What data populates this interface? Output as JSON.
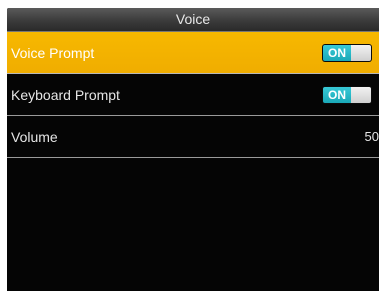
{
  "title": "Voice",
  "items": [
    {
      "label": "Voice Prompt",
      "toggle": "ON",
      "selected": true
    },
    {
      "label": "Keyboard Prompt",
      "toggle": "ON",
      "selected": false
    },
    {
      "label": "Volume",
      "value": "50",
      "selected": false
    }
  ],
  "colors": {
    "highlight": "#f5b300",
    "toggle_on": "#22b4c2",
    "background": "#050505"
  }
}
